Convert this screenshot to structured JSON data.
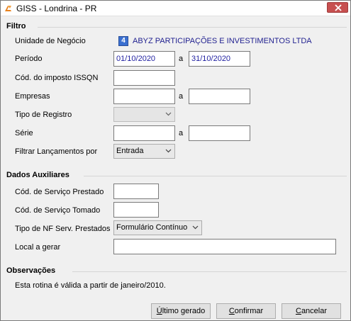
{
  "window": {
    "title": "GISS - Londrina - PR"
  },
  "filtro": {
    "title": "Filtro",
    "unidade_label": "Unidade de Negócio",
    "unidade_code": "4",
    "unidade_name": "ABYZ PARTICIPAÇÕES E INVESTIMENTOS LTDA",
    "periodo_label": "Período",
    "periodo_start": "01/10/2020",
    "periodo_sep": "a",
    "periodo_end": "31/10/2020",
    "cod_imposto_label": "Cód. do imposto ISSQN",
    "cod_imposto_value": "",
    "empresas_label": "Empresas",
    "empresas_start": "",
    "empresas_sep": "a",
    "empresas_end": "",
    "tipo_registro_label": "Tipo de Registro",
    "tipo_registro_value": "",
    "serie_label": "Série",
    "serie_start": "",
    "serie_sep": "a",
    "serie_end": "",
    "filtrar_label": "Filtrar Lançamentos por",
    "filtrar_value": "Entrada"
  },
  "dados": {
    "title": "Dados Auxiliares",
    "servico_prestado_label": "Cód. de Serviço Prestado",
    "servico_prestado_value": "",
    "servico_tomado_label": "Cód. de Serviço Tomado",
    "servico_tomado_value": "",
    "tipo_nf_label": "Tipo de NF Serv. Prestados",
    "tipo_nf_value": "Formulário Contínuo",
    "local_label": "Local a gerar",
    "local_value": ""
  },
  "observacoes": {
    "title": "Observações",
    "text": "Esta rotina é válida a partir de janeiro/2010."
  },
  "buttons": {
    "ultimo_prefix": "Ú",
    "ultimo_rest": "ltimo gerado",
    "confirmar_prefix": "C",
    "confirmar_rest": "onfirmar",
    "cancelar_prefix": "C",
    "cancelar_rest": "ancelar"
  }
}
